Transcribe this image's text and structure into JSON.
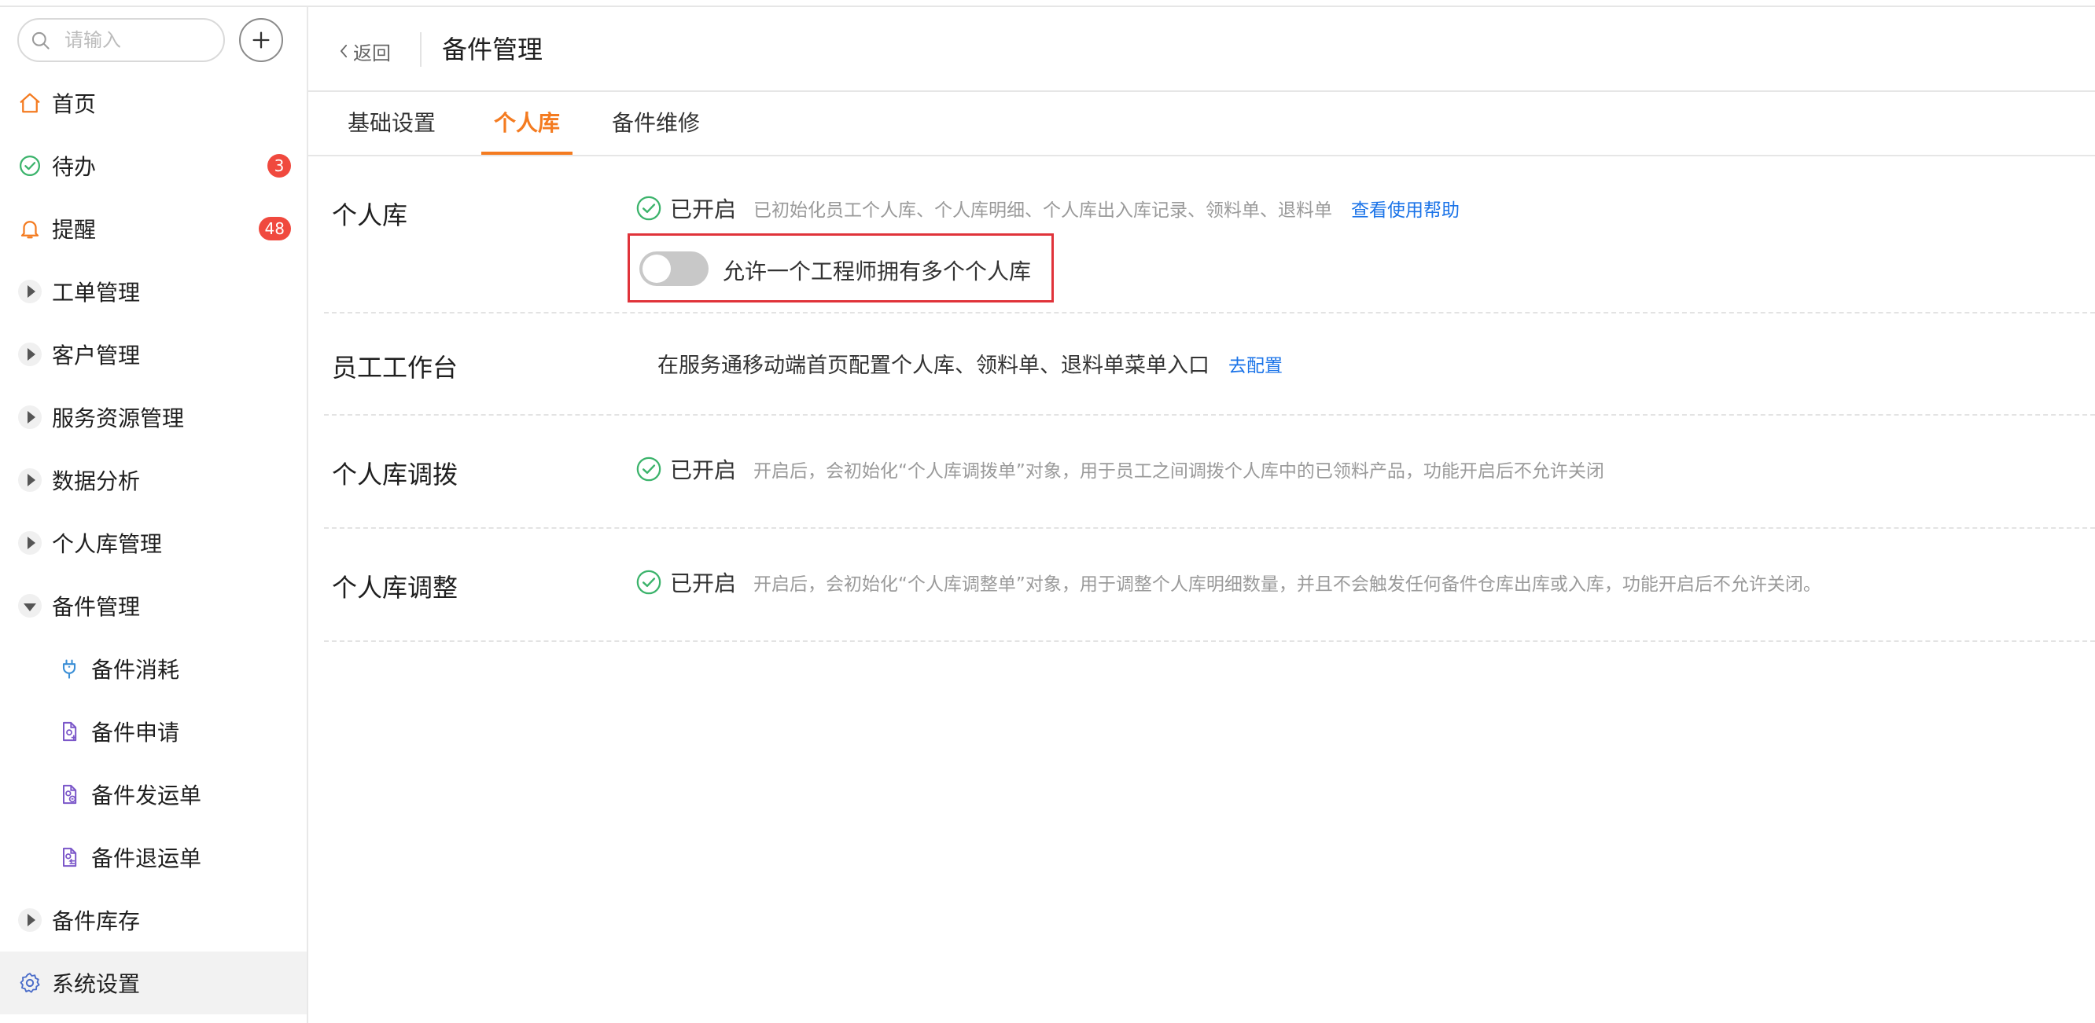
{
  "sidebar": {
    "search": {
      "placeholder": "请输入"
    },
    "items": [
      {
        "label": "首页"
      },
      {
        "label": "待办",
        "badge": "3"
      },
      {
        "label": "提醒",
        "badge": "48"
      },
      {
        "label": "工单管理"
      },
      {
        "label": "客户管理"
      },
      {
        "label": "服务资源管理"
      },
      {
        "label": "数据分析"
      },
      {
        "label": "个人库管理"
      },
      {
        "label": "备件管理"
      },
      {
        "label": "备件消耗"
      },
      {
        "label": "备件申请"
      },
      {
        "label": "备件发运单"
      },
      {
        "label": "备件退运单"
      },
      {
        "label": "备件库存"
      },
      {
        "label": "系统设置"
      }
    ]
  },
  "header": {
    "back_label": "返回",
    "title": "备件管理"
  },
  "tabs": [
    {
      "label": "基础设置"
    },
    {
      "label": "个人库"
    },
    {
      "label": "备件维修"
    }
  ],
  "sections": {
    "personal_library": {
      "title": "个人库",
      "status": "已开启",
      "desc": "已初始化员工个人库、个人库明细、个人库出入库记录、领料单、退料单",
      "link": "查看使用帮助",
      "toggle_label": "允许一个工程师拥有多个个人库"
    },
    "workbench": {
      "title": "员工工作台",
      "desc": "在服务通移动端首页配置个人库、领料单、退料单菜单入口",
      "link": "去配置"
    },
    "transfer": {
      "title": "个人库调拨",
      "status": "已开启",
      "desc": "开启后，会初始化“个人库调拨单”对象，用于员工之间调拨个人库中的已领料产品，功能开启后不允许关闭"
    },
    "adjust": {
      "title": "个人库调整",
      "status": "已开启",
      "desc": "开启后，会初始化“个人库调整单”对象，用于调整个人库明细数量，并且不会触发任何备件仓库出库或入库，功能开启后不允许关闭。"
    }
  },
  "colors": {
    "accent": "#f47b20",
    "link": "#1a73e8",
    "badge": "#f0493e",
    "success": "#3bb36b",
    "highlight_border": "#e0333a"
  }
}
